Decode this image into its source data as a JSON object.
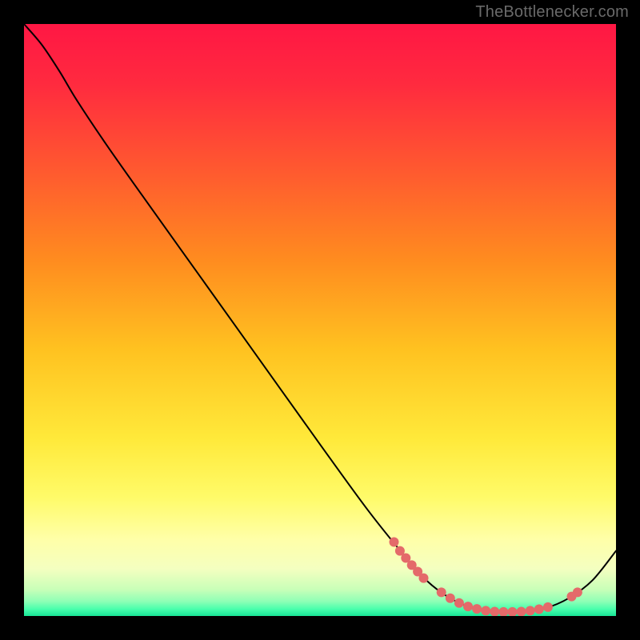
{
  "watermark": "TheBottlenecker.com",
  "chart_data": {
    "type": "line",
    "title": "",
    "xlabel": "",
    "ylabel": "",
    "xlim": [
      0,
      100
    ],
    "ylim": [
      0,
      100
    ],
    "grid": false,
    "legend": false,
    "background_gradient": {
      "stops": [
        {
          "offset": 0.0,
          "color": "#ff1744"
        },
        {
          "offset": 0.1,
          "color": "#ff2a3f"
        },
        {
          "offset": 0.25,
          "color": "#ff5a2f"
        },
        {
          "offset": 0.4,
          "color": "#ff8c1f"
        },
        {
          "offset": 0.55,
          "color": "#ffc220"
        },
        {
          "offset": 0.7,
          "color": "#ffe93a"
        },
        {
          "offset": 0.8,
          "color": "#fffb69"
        },
        {
          "offset": 0.87,
          "color": "#ffffa8"
        },
        {
          "offset": 0.92,
          "color": "#f4ffc0"
        },
        {
          "offset": 0.955,
          "color": "#c9ffb8"
        },
        {
          "offset": 0.975,
          "color": "#8fffb6"
        },
        {
          "offset": 0.988,
          "color": "#4affad"
        },
        {
          "offset": 1.0,
          "color": "#18e596"
        }
      ]
    },
    "series": [
      {
        "name": "curve",
        "stroke": "#000000",
        "stroke_width": 2,
        "points": [
          {
            "x": 0.0,
            "y": 100.0
          },
          {
            "x": 3.0,
            "y": 96.5
          },
          {
            "x": 6.0,
            "y": 92.0
          },
          {
            "x": 9.0,
            "y": 87.0
          },
          {
            "x": 14.0,
            "y": 79.5
          },
          {
            "x": 20.0,
            "y": 71.0
          },
          {
            "x": 30.0,
            "y": 57.0
          },
          {
            "x": 40.0,
            "y": 43.0
          },
          {
            "x": 50.0,
            "y": 29.0
          },
          {
            "x": 58.0,
            "y": 18.0
          },
          {
            "x": 64.0,
            "y": 10.5
          },
          {
            "x": 68.0,
            "y": 6.0
          },
          {
            "x": 72.0,
            "y": 3.0
          },
          {
            "x": 76.0,
            "y": 1.3
          },
          {
            "x": 80.0,
            "y": 0.7
          },
          {
            "x": 84.0,
            "y": 0.7
          },
          {
            "x": 88.0,
            "y": 1.3
          },
          {
            "x": 92.0,
            "y": 3.0
          },
          {
            "x": 96.0,
            "y": 6.0
          },
          {
            "x": 100.0,
            "y": 11.0
          }
        ]
      }
    ],
    "markers": {
      "color": "#e46a6a",
      "radius": 6,
      "points": [
        {
          "x": 62.5,
          "y": 12.5
        },
        {
          "x": 63.5,
          "y": 11.0
        },
        {
          "x": 64.5,
          "y": 9.8
        },
        {
          "x": 65.5,
          "y": 8.6
        },
        {
          "x": 66.5,
          "y": 7.5
        },
        {
          "x": 67.5,
          "y": 6.4
        },
        {
          "x": 70.5,
          "y": 4.0
        },
        {
          "x": 72.0,
          "y": 3.0
        },
        {
          "x": 73.5,
          "y": 2.2
        },
        {
          "x": 75.0,
          "y": 1.6
        },
        {
          "x": 76.5,
          "y": 1.2
        },
        {
          "x": 78.0,
          "y": 0.9
        },
        {
          "x": 79.5,
          "y": 0.75
        },
        {
          "x": 81.0,
          "y": 0.7
        },
        {
          "x": 82.5,
          "y": 0.7
        },
        {
          "x": 84.0,
          "y": 0.75
        },
        {
          "x": 85.5,
          "y": 0.9
        },
        {
          "x": 87.0,
          "y": 1.15
        },
        {
          "x": 88.5,
          "y": 1.5
        },
        {
          "x": 92.5,
          "y": 3.3
        },
        {
          "x": 93.5,
          "y": 4.0
        }
      ]
    }
  }
}
